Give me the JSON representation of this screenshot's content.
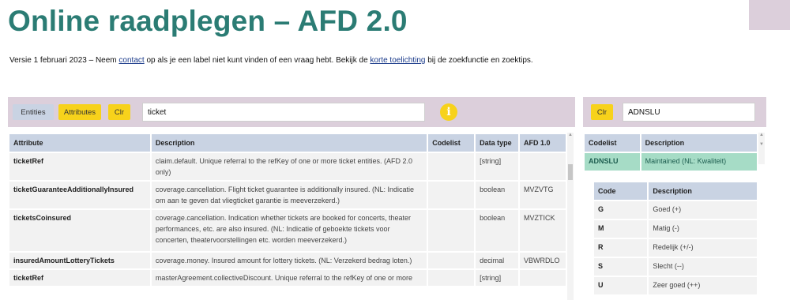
{
  "page": {
    "title": "Online raadplegen – AFD 2.0",
    "intro": {
      "part1": "Versie 1 februari 2023 – Neem ",
      "contact_link": "contact",
      "part2": " op als je een label niet kunt vinden of een vraag hebt. Bekijk de ",
      "help_link": "korte toelichting",
      "part3": " bij de zoekfunctie en zoektips."
    }
  },
  "left_panel": {
    "buttons": {
      "entities": "Entities",
      "attributes": "Attributes",
      "clear": "Clr"
    },
    "search_value": "ticket",
    "info_icon": "info-icon",
    "columns": [
      "Attribute",
      "Description",
      "Codelist",
      "Data type",
      "AFD 1.0"
    ],
    "rows": [
      {
        "attribute": "ticketRef",
        "description": "claim.default. Unique referral to the refKey of one or more ticket entities. (AFD 2.0 only)",
        "codelist": "",
        "datatype": "[string]",
        "afd": ""
      },
      {
        "attribute": "ticketGuaranteeAdditionallyInsured",
        "description": "coverage.cancellation. Flight ticket guarantee is additionally insured. (NL: Indicatie om aan te geven dat vliegticket garantie is meeverzekerd.)",
        "codelist": "",
        "datatype": "boolean",
        "afd": "MVZVTG"
      },
      {
        "attribute": "ticketsCoinsured",
        "description": "coverage.cancellation. Indication whether tickets are booked for concerts, theater performances, etc. are also insured. (NL: Indicatie of geboekte tickets voor concerten, theatervoorstellingen etc. worden meeverzekerd.)",
        "codelist": "",
        "datatype": "boolean",
        "afd": "MVZTICK"
      },
      {
        "attribute": "insuredAmountLotteryTickets",
        "description": "coverage.money. Insured amount for lottery tickets. (NL: Verzekerd bedrag loten.)",
        "codelist": "",
        "datatype": "decimal",
        "afd": "VBWRDLO"
      },
      {
        "attribute": "ticketRef",
        "description": "masterAgreement.collectiveDiscount. Unique referral to the refKey of one or more",
        "codelist": "",
        "datatype": "[string]",
        "afd": ""
      }
    ]
  },
  "right_panel": {
    "buttons": {
      "clear": "Clr"
    },
    "search_value": "ADNSLU",
    "columns": [
      "Codelist",
      "Description"
    ],
    "selected": {
      "codelist": "ADNSLU",
      "description": "Maintained (NL: Kwaliteit)"
    },
    "code_columns": [
      "Code",
      "Description"
    ],
    "codes": [
      {
        "code": "G",
        "description": "Goed (+)"
      },
      {
        "code": "M",
        "description": "Matig (-)"
      },
      {
        "code": "R",
        "description": "Redelijk (+/-)"
      },
      {
        "code": "S",
        "description": "Slecht (--)"
      },
      {
        "code": "U",
        "description": "Zeer goed (++)"
      }
    ]
  },
  "colors": {
    "accent": "#2b7c74",
    "yellow": "#f7d21b",
    "bar": "#dccfdb",
    "header": "#c9d3e3",
    "selected": "#a6dcc6"
  }
}
